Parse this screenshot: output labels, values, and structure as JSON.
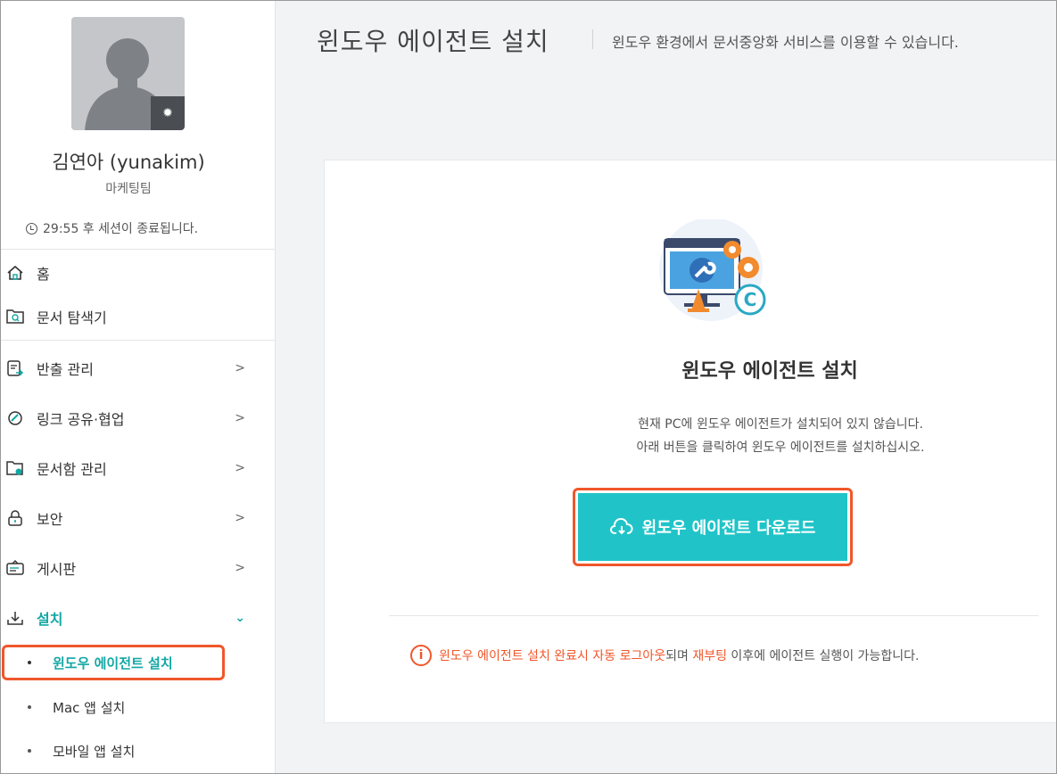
{
  "user": {
    "name": "김연아 (yunakim)",
    "team": "마케팅팀",
    "session": "29:55 후 세션이 종료됩니다."
  },
  "nav": {
    "home": "홈",
    "explorer": "문서 탐색기",
    "items": [
      {
        "label": "반출 관리",
        "icon": "export-doc-icon"
      },
      {
        "label": "링크 공유·협업",
        "icon": "link-share-icon"
      },
      {
        "label": "문서함 관리",
        "icon": "folder-settings-icon"
      },
      {
        "label": "보안",
        "icon": "lock-icon"
      },
      {
        "label": "게시판",
        "icon": "board-icon"
      },
      {
        "label": "설치",
        "icon": "install-icon"
      }
    ],
    "sub": [
      {
        "label": "윈도우 에이전트 설치"
      },
      {
        "label": "Mac 앱 설치"
      },
      {
        "label": "모바일 앱 설치"
      }
    ]
  },
  "header": {
    "title": "윈도우 에이전트 설치",
    "desc": "윈도우 환경에서 문서중앙화 서비스를 이용할 수 있습니다."
  },
  "card": {
    "title": "윈도우 에이전트 설치",
    "msg1": "현재 PC에 윈도우 에이전트가 설치되어 있지 않습니다.",
    "msg2": "아래 버튼을 클릭하여 윈도우 에이전트를 설치하십시오.",
    "button": "윈도우 에이전트 다운로드",
    "notice_a": "윈도우 에이전트 설치 완료시 자동 로그아웃",
    "notice_b": "되며 ",
    "notice_c": "재부팅",
    "notice_d": " 이후에 에이전트 실행이 가능합니다."
  },
  "colors": {
    "accent": "#20c4c8",
    "active": "#12a7a4",
    "highlight": "#f0572b"
  }
}
